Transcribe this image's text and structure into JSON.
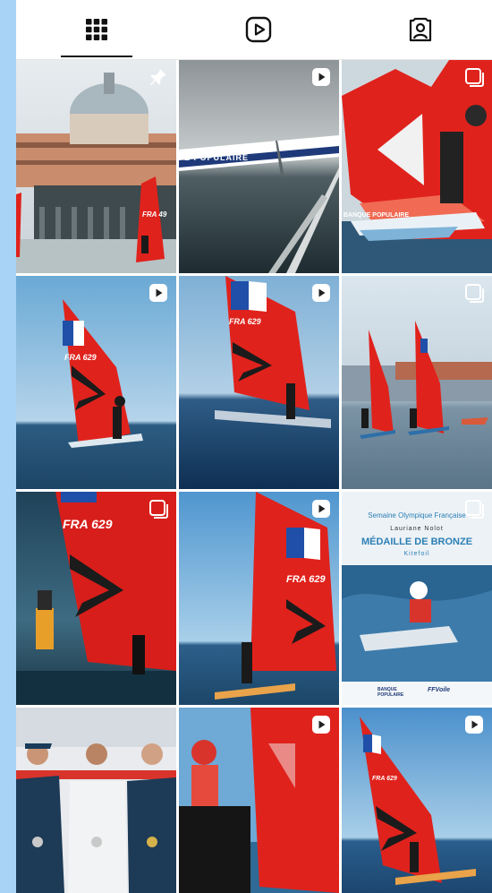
{
  "tabs": [
    {
      "name": "grid",
      "icon": "grid-icon",
      "active": true
    },
    {
      "name": "reels",
      "icon": "reels-icon",
      "active": false
    },
    {
      "name": "tagged",
      "icon": "tagged-icon",
      "active": false
    }
  ],
  "posts": [
    {
      "id": 1,
      "badge": "pin-icon",
      "overlay": "FRA 49"
    },
    {
      "id": 2,
      "badge": "reel-icon",
      "overlay": "E POPULAIRE"
    },
    {
      "id": 3,
      "badge": "carousel-icon",
      "overlay": "BANQUE POPULAIRE"
    },
    {
      "id": 4,
      "badge": "reel-icon",
      "overlay": "FRA 629"
    },
    {
      "id": 5,
      "badge": "reel-icon",
      "overlay": "FRA 629"
    },
    {
      "id": 6,
      "badge": "carousel-icon",
      "overlay": ""
    },
    {
      "id": 7,
      "badge": "carousel-icon",
      "overlay": "FRA 629"
    },
    {
      "id": 8,
      "badge": "reel-icon",
      "overlay": "FRA 629"
    },
    {
      "id": 9,
      "badge": "carousel-icon",
      "poster": {
        "line1": "Semaine Olympique Française",
        "line2": "Lauriane Nolot",
        "line3": "MÉDAILLE DE BRONZE",
        "line4": "Kitefoil",
        "footer1": "BANQUE POPULAIRE",
        "footer2": "FFVoile"
      }
    },
    {
      "id": 10,
      "badge": "",
      "overlay": ""
    },
    {
      "id": 11,
      "badge": "reel-icon",
      "overlay": ""
    },
    {
      "id": 12,
      "badge": "reel-icon",
      "overlay": "FRA 629"
    }
  ],
  "colors": {
    "background": "#a9d3f6",
    "sail_red": "#e0221c",
    "sea": "#2b5d86",
    "sky": "#8fbde0"
  }
}
